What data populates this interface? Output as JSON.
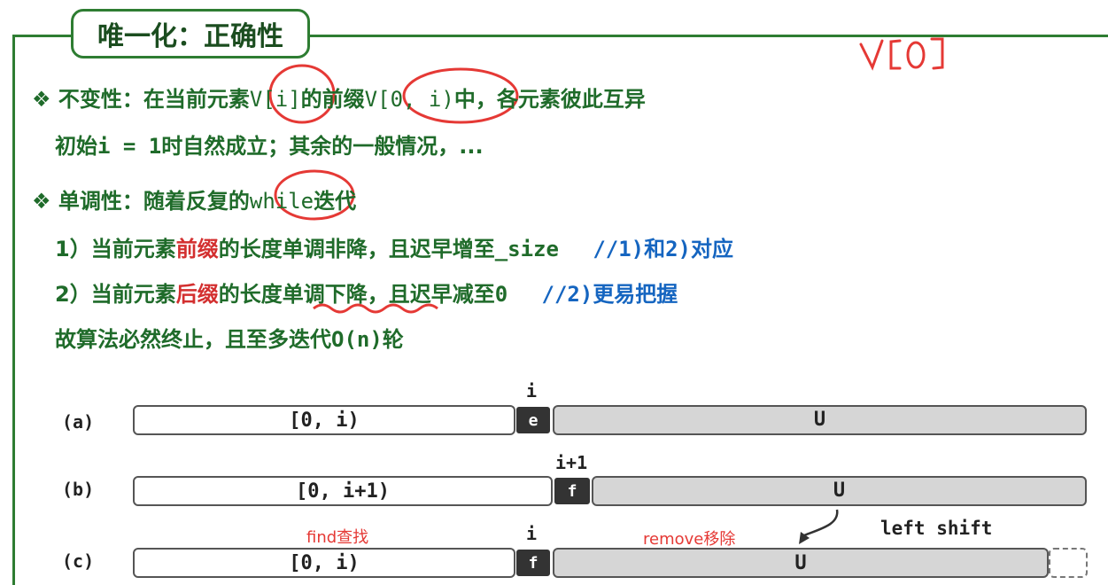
{
  "title": "唯一化：正确性",
  "handwritten_note": "V[0]",
  "invariant": {
    "bullet": "❖",
    "p1": "不变性：在当前元素",
    "p2": "V[i]",
    "p3": "的前缀",
    "p4": "V[0, i)",
    "p5": "中，各元素彼此互异"
  },
  "init_line": {
    "p1": "初始",
    "p2": "i = 1",
    "p3": "时自然成立；其余的一般情况，..."
  },
  "monotone": {
    "bullet": "❖",
    "p1": "单调性：随着反复的",
    "p2": "while",
    "p3": "迭代"
  },
  "point1": {
    "p1": "1）当前元素",
    "red": "前缀",
    "p2": "的长度单调非降，且迟早增至",
    "p3": "_size",
    "comment": "//1)和2)对应"
  },
  "point2": {
    "p1": "2）当前元素",
    "red": "后缀",
    "p2": "的长度",
    "p2b": "单调下降",
    "p3": "，且迟早减至",
    "p4": "0",
    "comment": "//2)更易把握"
  },
  "conclusion": {
    "p1": "故算法必然终止，且至多迭代",
    "p2": "O(n)",
    "p3": "轮"
  },
  "rows": [
    {
      "label": "(a)",
      "prefix": "[0, i)",
      "elem": "e",
      "suffix": "U",
      "index": "i"
    },
    {
      "label": "(b)",
      "prefix": "[0, i+1)",
      "elem": "f",
      "suffix": "U",
      "index": "i+1"
    },
    {
      "label": "(c)",
      "prefix": "[0, i)",
      "elem": "f",
      "suffix": "U",
      "index": "i"
    }
  ],
  "annotations": {
    "find": "find查找",
    "remove": "remove移除",
    "shift": "left shift"
  },
  "colors": {
    "frame": "#2e7d32",
    "text": "#1f6b2a",
    "emphasis": "#d32f2f",
    "comment": "#1565c0",
    "ink": "#e53935"
  }
}
